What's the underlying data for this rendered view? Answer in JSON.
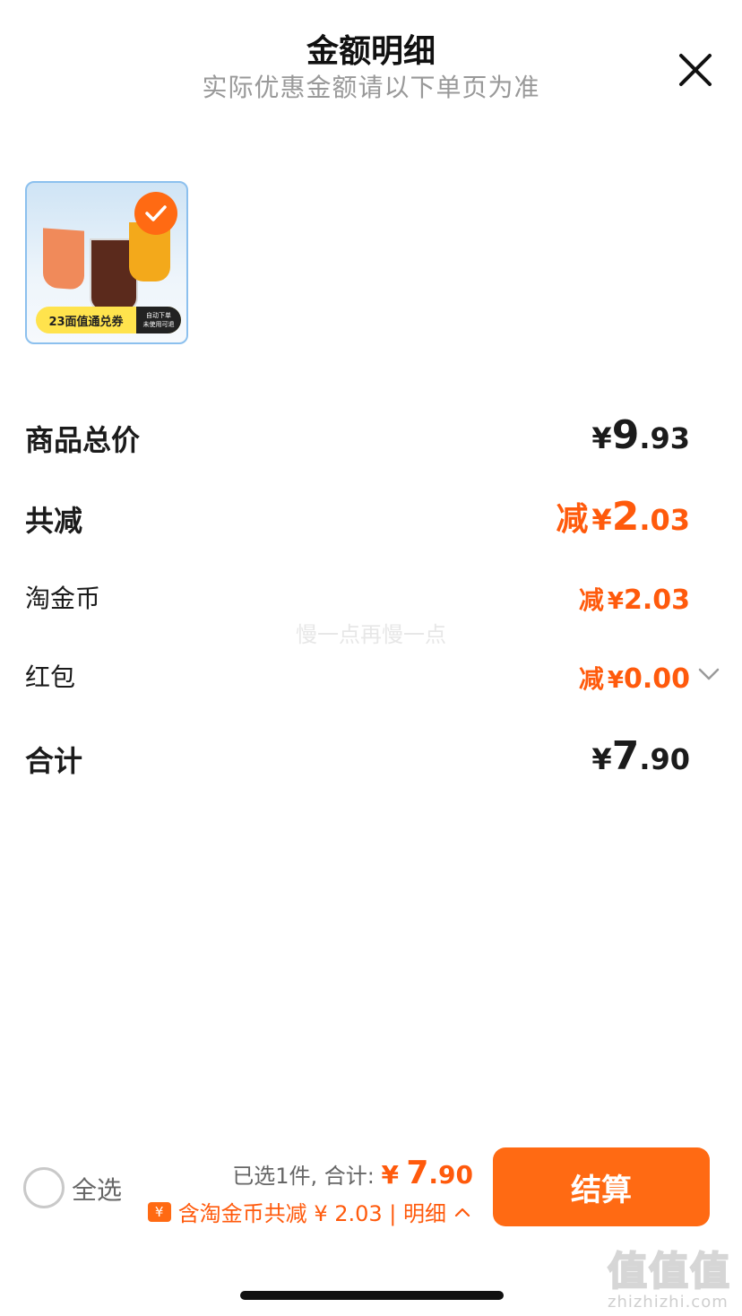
{
  "header": {
    "title": "金额明细",
    "subtitle": "实际优惠金额请以下单页为准"
  },
  "product": {
    "tag_main": "23面值通兑券",
    "tag_side_1": "自动下单",
    "tag_side_2": "未使用可退"
  },
  "rows": {
    "total": {
      "label": "商品总价",
      "yen": "¥",
      "int": "9",
      "dec": ".93"
    },
    "reduction": {
      "label": "共减",
      "prefix": "减",
      "yen": "¥",
      "int": "2",
      "dec": ".03"
    },
    "coins": {
      "label": "淘金币",
      "prefix": "减",
      "yen": "¥",
      "int": "2",
      "dec": ".03"
    },
    "redpacket": {
      "label": "红包",
      "prefix": "减",
      "yen": "¥",
      "int": "0",
      "dec": ".00"
    },
    "sum": {
      "label": "合计",
      "yen": "¥",
      "int": "7",
      "dec": ".90"
    }
  },
  "watermark": "慢一点再慢一点",
  "bottom": {
    "select_all": "全选",
    "selected_text": "已选1件, 合计:",
    "amt_yen": "¥",
    "amt_int": "7",
    "amt_dec": ".90",
    "coin_badge": "¥",
    "discount_text": "含淘金币共减 ¥ 2.03 | 明细",
    "checkout": "结算"
  },
  "brand": {
    "logo_text": "值值值",
    "domain": "zhizhizhi.com"
  },
  "colors": {
    "accent": "#ff6a13",
    "discount": "#ff5a0c",
    "text": "#1b1b1b",
    "muted": "#999999"
  }
}
